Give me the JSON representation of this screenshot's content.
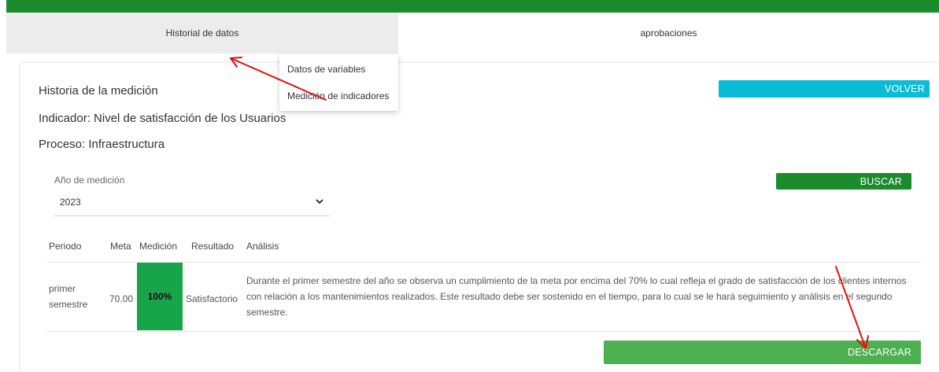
{
  "tabs": [
    {
      "label": "Historial de datos",
      "active": true
    },
    {
      "label": "aprobaciones",
      "active": false
    }
  ],
  "dropdown": {
    "items": [
      "Datos de variables",
      "Medición de indicadores"
    ]
  },
  "header": {
    "title": "Historia de la medición",
    "indicator": "Indicador: Nivel de satisfacción de los Usuarios",
    "process": "Proceso: Infraestructura"
  },
  "buttons": {
    "volver": "VOLVER",
    "buscar": "BUSCAR",
    "descargar": "DESCARGAR"
  },
  "filter": {
    "label": "Año de medición",
    "value": "2023"
  },
  "table": {
    "headers": [
      "Periodo",
      "Meta",
      "Medición",
      "Resultado",
      "Análisis"
    ],
    "rows": [
      {
        "periodo": "primer semestre",
        "meta": "70.00",
        "medicion": "100%",
        "resultado": "Satisfactorio",
        "analisis": "Durante el primer semestre del año se observa un cumplimiento de la meta por encima del 70% lo cual refleja el grado de satisfacción de los clientes internos con relación a los mantenimientos realizados. Este resultado debe ser sostenido en el tiempo, para lo cual se le hará seguimiento y análisis en el segundo semestre."
      }
    ]
  },
  "colors": {
    "brand_green": "#1b8b2e",
    "volver_cyan": "#0bbcd6",
    "descargar_green": "#4caf50",
    "measurement_cell": "#18a54a",
    "annotation_arrow": "#e01010"
  }
}
